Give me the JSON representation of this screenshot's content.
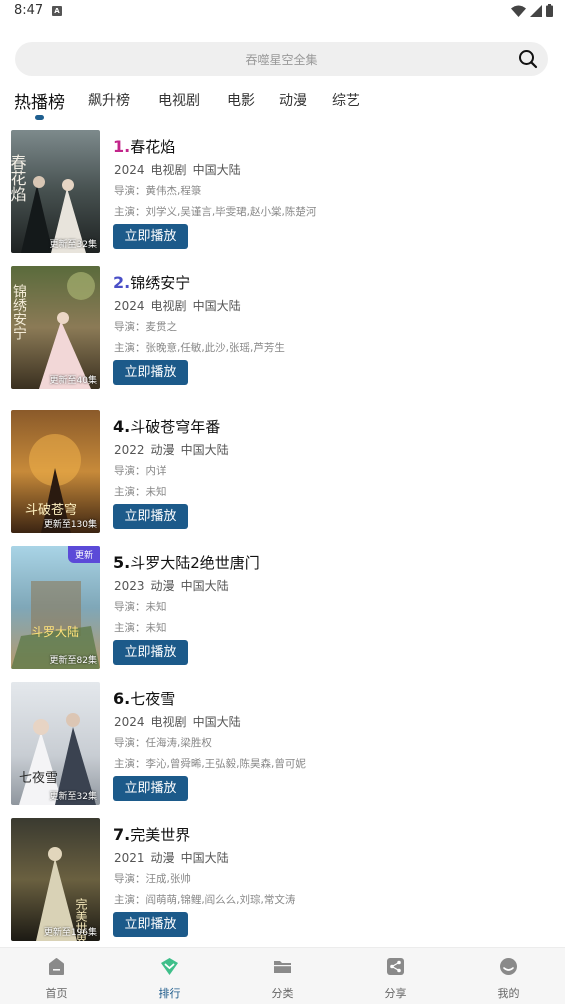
{
  "status_bar": {
    "time": "8:47",
    "notification_icon": "A"
  },
  "search": {
    "placeholder": "吞噬星空全集"
  },
  "tabs": [
    {
      "label": "热播榜",
      "active": true
    },
    {
      "label": "飙升榜",
      "active": false
    },
    {
      "label": "电视剧",
      "active": false
    },
    {
      "label": "电影",
      "active": false
    },
    {
      "label": "动漫",
      "active": false
    },
    {
      "label": "综艺",
      "active": false
    }
  ],
  "list": [
    {
      "rank": "1.",
      "rank_color": "#c2258a",
      "title": "春花焰",
      "year": "2024",
      "type": "电视剧",
      "region": "中国大陆",
      "director": "导演：黄伟杰,程箓",
      "cast": "主演：刘学义,吴谨言,毕雯珺,赵小棠,陈楚河",
      "poster_caption": "更新至32集",
      "poster_text": "春花焰",
      "badge": "",
      "play_label": "立即播放"
    },
    {
      "rank": "2.",
      "rank_color": "#4a4fc7",
      "title": "锦绣安宁",
      "year": "2024",
      "type": "电视剧",
      "region": "中国大陆",
      "director": "导演：麦贯之",
      "cast": "主演：张晚意,任敏,此沙,张瑶,芦芳生",
      "poster_caption": "更新至40集",
      "poster_text": "锦绣安宁",
      "badge": "",
      "play_label": "立即播放"
    },
    {
      "rank": "4.",
      "rank_color": "#111111",
      "title": "斗破苍穹年番",
      "year": "2022",
      "type": "动漫",
      "region": "中国大陆",
      "director": "导演：内详",
      "cast": "主演：未知",
      "poster_caption": "更新至130集",
      "poster_text": "斗破苍穹",
      "badge": "",
      "play_label": "立即播放"
    },
    {
      "rank": "5.",
      "rank_color": "#111111",
      "title": "斗罗大陆2绝世唐门",
      "year": "2023",
      "type": "动漫",
      "region": "中国大陆",
      "director": "导演：未知",
      "cast": "主演：未知",
      "poster_caption": "更新至82集",
      "poster_text": "斗罗大陆",
      "badge": "更新",
      "play_label": "立即播放"
    },
    {
      "rank": "6.",
      "rank_color": "#111111",
      "title": "七夜雪",
      "year": "2024",
      "type": "电视剧",
      "region": "中国大陆",
      "director": "导演：任海涛,梁胜权",
      "cast": "主演：李沁,曾舜晞,王弘毅,陈昊森,曾可妮",
      "poster_caption": "更新至32集",
      "poster_text": "七夜雪",
      "badge": "",
      "play_label": "立即播放"
    },
    {
      "rank": "7.",
      "rank_color": "#111111",
      "title": "完美世界",
      "year": "2021",
      "type": "动漫",
      "region": "中国大陆",
      "director": "导演：汪成,张帅",
      "cast": "主演：阎萌萌,锦鲤,阎么么,刘琮,常文涛",
      "poster_caption": "更新至196集",
      "poster_text": "完美世界",
      "badge": "",
      "play_label": "立即播放"
    }
  ],
  "bottom_nav": [
    {
      "label": "首页",
      "icon": "home-icon",
      "active": false
    },
    {
      "label": "排行",
      "icon": "ranking-icon",
      "active": true
    },
    {
      "label": "分类",
      "icon": "folder-icon",
      "active": false
    },
    {
      "label": "分享",
      "icon": "share-icon",
      "active": false
    },
    {
      "label": "我的",
      "icon": "profile-icon",
      "active": false
    }
  ],
  "colors": {
    "accent": "#1c5a8a",
    "active_nav": "#3fbf8a",
    "badge": "#5b4ad8"
  }
}
